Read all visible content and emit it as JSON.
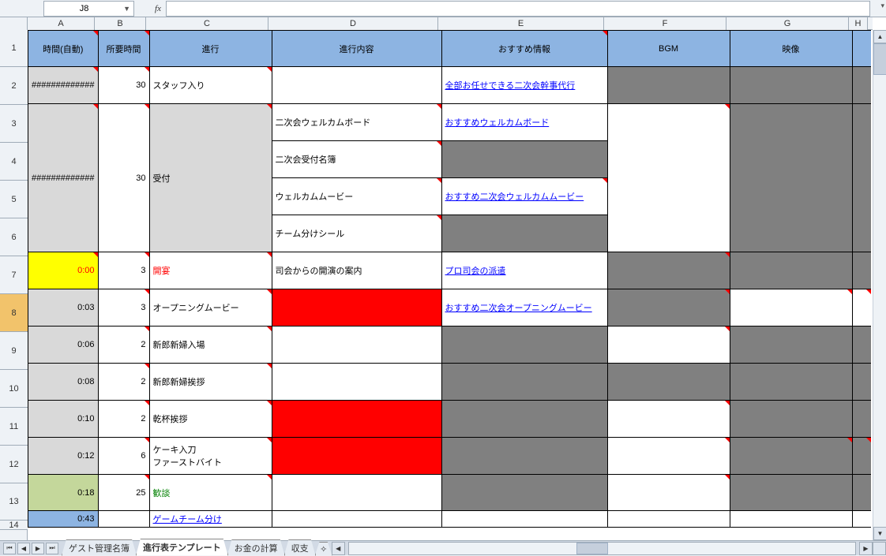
{
  "namebox": "J8",
  "fx_label": "fx",
  "columns": [
    "A",
    "B",
    "C",
    "D",
    "E",
    "F",
    "G",
    "H"
  ],
  "row_numbers": [
    1,
    2,
    3,
    4,
    5,
    6,
    7,
    8,
    9,
    10,
    11,
    12,
    13,
    14
  ],
  "selected_row": 8,
  "headers": {
    "A": "時間(自動)",
    "B": "所要時間",
    "C": "進行",
    "D": "進行内容",
    "E": "おすすめ情報",
    "F": "BGM",
    "G": "映像"
  },
  "rows": {
    "2": {
      "A": "#############",
      "B": "30",
      "C": "スタッフ入り",
      "D": "",
      "E_link": "全部お任せできる二次会幹事代行"
    },
    "3": {
      "D": "二次会ウェルカムボード",
      "E_link": "おすすめウェルカムボード"
    },
    "4": {
      "A": "#############",
      "B": "30",
      "C": "受付",
      "D": "二次会受付名簿"
    },
    "5": {
      "D": "ウェルカムムービー",
      "E_link": "おすすめ二次会ウェルカムムービー"
    },
    "6": {
      "D": "チーム分けシール"
    },
    "7": {
      "A": "0:00",
      "B": "3",
      "C": "開宴",
      "D": "司会からの開演の案内",
      "E_link": "プロ司会の派遣"
    },
    "8": {
      "A": "0:03",
      "B": "3",
      "C": "オープニングムービー",
      "E_link": "おすすめ二次会オープニングムービー"
    },
    "9": {
      "A": "0:06",
      "B": "2",
      "C": "新郎新婦入場"
    },
    "10": {
      "A": "0:08",
      "B": "2",
      "C": "新郎新婦挨拶"
    },
    "11": {
      "A": "0:10",
      "B": "2",
      "C": "乾杯挨拶"
    },
    "12": {
      "A": "0:12",
      "B": "6",
      "C": "ケーキ入刀\nファーストバイト"
    },
    "13": {
      "A": "0:18",
      "B": "25",
      "C": "歓談"
    },
    "14": {
      "A": "0:43",
      "C": "ゲームチーム分け"
    }
  },
  "sheet_tabs": {
    "tabs": [
      "ゲスト管理名簿",
      "進行表テンプレート",
      "お金の計算",
      "収支"
    ],
    "active_index": 1,
    "insert_icon": "✧"
  },
  "nav_icons": [
    "⏮",
    "◀",
    "▶",
    "⏭"
  ],
  "scroll_up": "▲",
  "scroll_down": "▼",
  "scroll_left": "◀",
  "scroll_right": "▶",
  "chart_data": {
    "type": "table",
    "columns": [
      "時間(自動)",
      "所要時間",
      "進行",
      "進行内容",
      "おすすめ情報",
      "BGM",
      "映像"
    ],
    "rows": [
      [
        "#############",
        30,
        "スタッフ入り",
        "",
        "全部お任せできる二次会幹事代行",
        "",
        ""
      ],
      [
        "#############",
        30,
        "受付",
        "二次会ウェルカムボード",
        "おすすめウェルカムボード",
        "",
        ""
      ],
      [
        "",
        "",
        "",
        "二次会受付名簿",
        "",
        "",
        ""
      ],
      [
        "",
        "",
        "",
        "ウェルカムムービー",
        "おすすめ二次会ウェルカムムービー",
        "",
        ""
      ],
      [
        "",
        "",
        "",
        "チーム分けシール",
        "",
        "",
        ""
      ],
      [
        "0:00",
        3,
        "開宴",
        "司会からの開演の案内",
        "プロ司会の派遣",
        "",
        ""
      ],
      [
        "0:03",
        3,
        "オープニングムービー",
        "",
        "おすすめ二次会オープニングムービー",
        "",
        ""
      ],
      [
        "0:06",
        2,
        "新郎新婦入場",
        "",
        "",
        "",
        ""
      ],
      [
        "0:08",
        2,
        "新郎新婦挨拶",
        "",
        "",
        "",
        ""
      ],
      [
        "0:10",
        2,
        "乾杯挨拶",
        "",
        "",
        "",
        ""
      ],
      [
        "0:12",
        6,
        "ケーキ入刀 ファーストバイト",
        "",
        "",
        "",
        ""
      ],
      [
        "0:18",
        25,
        "歓談",
        "",
        "",
        "",
        ""
      ],
      [
        "0:43",
        "",
        "ゲームチーム分け",
        "",
        "",
        "",
        ""
      ]
    ]
  }
}
